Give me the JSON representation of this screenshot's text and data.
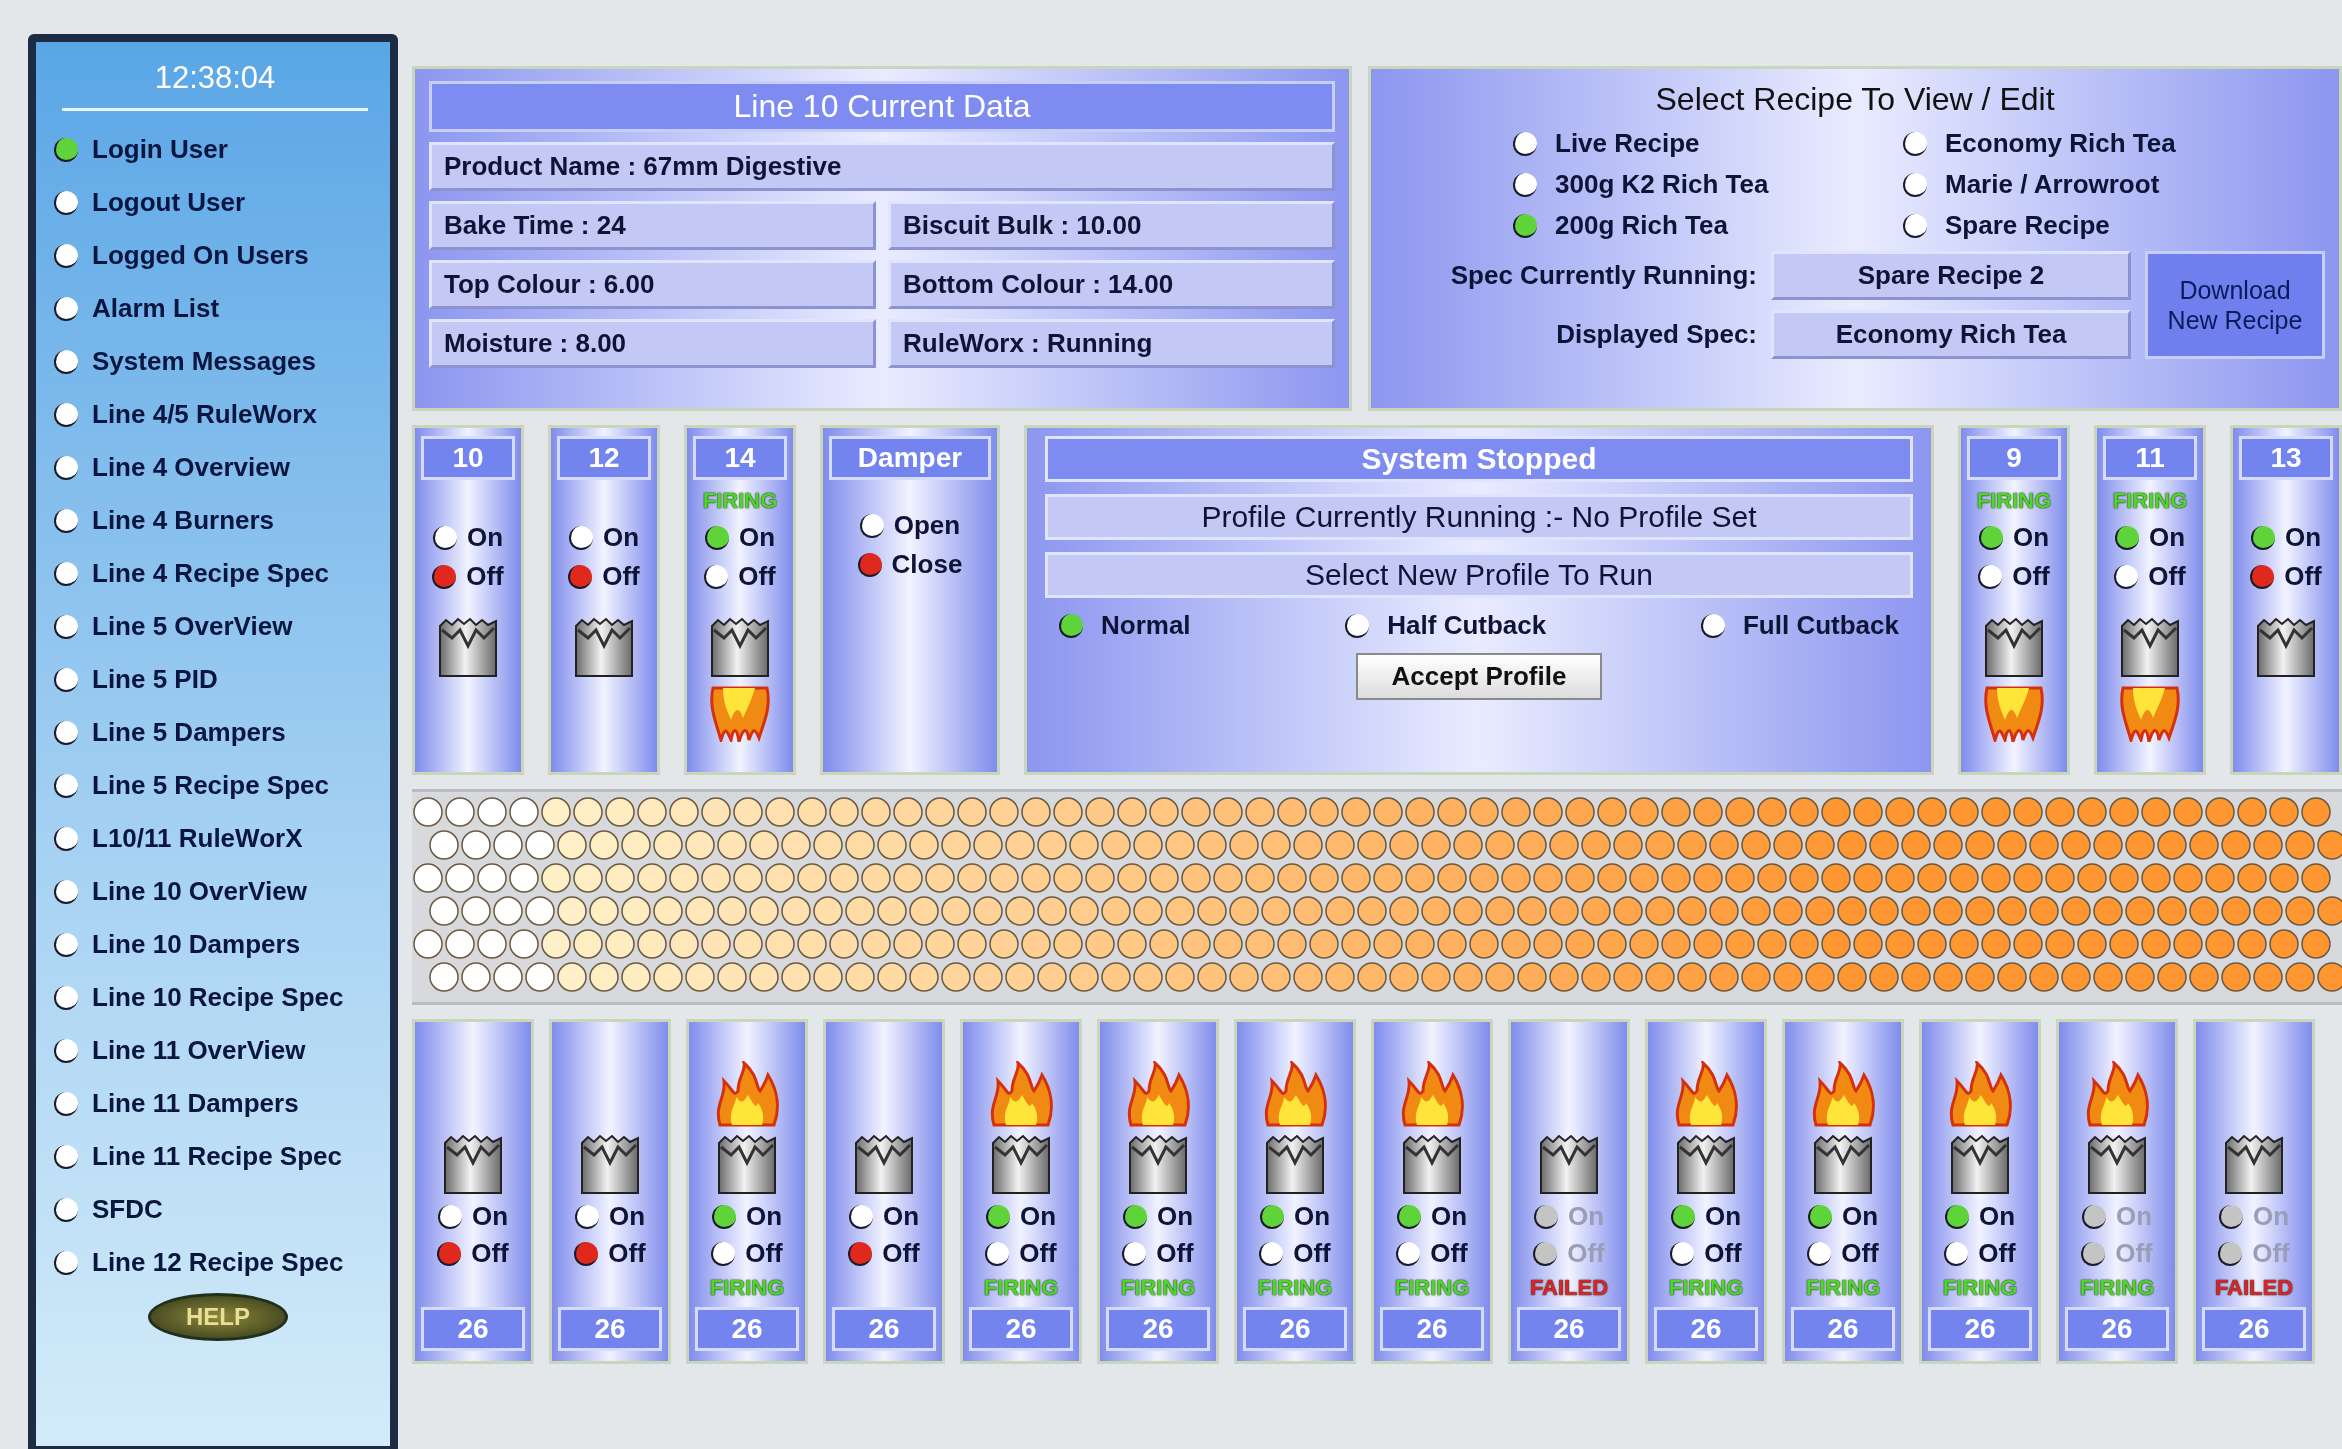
{
  "sidebar": {
    "clock": "12:38:04",
    "items": [
      {
        "label": "Login User",
        "selected": true
      },
      {
        "label": "Logout User",
        "selected": false
      },
      {
        "label": "Logged On Users",
        "selected": false
      },
      {
        "label": "Alarm List",
        "selected": false
      },
      {
        "label": "System Messages",
        "selected": false
      },
      {
        "label": "Line 4/5 RuleWorx",
        "selected": false
      },
      {
        "label": "Line 4 Overview",
        "selected": false
      },
      {
        "label": "Line 4 Burners",
        "selected": false
      },
      {
        "label": "Line 4 Recipe Spec",
        "selected": false
      },
      {
        "label": "Line 5 OverView",
        "selected": false
      },
      {
        "label": "Line 5 PID",
        "selected": false
      },
      {
        "label": "Line 5 Dampers",
        "selected": false
      },
      {
        "label": "Line 5 Recipe Spec",
        "selected": false
      },
      {
        "label": "L10/11 RuleWorX",
        "selected": false
      },
      {
        "label": "Line 10 OverView",
        "selected": false
      },
      {
        "label": "Line 10 Dampers",
        "selected": false
      },
      {
        "label": "Line 10 Recipe Spec",
        "selected": false
      },
      {
        "label": "Line 11 OverView",
        "selected": false
      },
      {
        "label": "Line 11 Dampers",
        "selected": false
      },
      {
        "label": "Line 11 Recipe Spec",
        "selected": false
      },
      {
        "label": "SFDC",
        "selected": false
      },
      {
        "label": "Line 12 Recipe Spec",
        "selected": false
      }
    ],
    "help_button": "HELP"
  },
  "current_data": {
    "title": "Line 10 Current Data",
    "product": "Product Name : 67mm Digestive",
    "fields": [
      "Bake Time : 24",
      "Biscuit Bulk : 10.00",
      "Top Colour : 6.00",
      "Bottom Colour : 14.00",
      "Moisture : 8.00",
      "RuleWorx : Running"
    ]
  },
  "recipe": {
    "title": "Select Recipe To View / Edit",
    "options": [
      {
        "label": "Live Recipe",
        "selected": false
      },
      {
        "label": "Economy Rich Tea",
        "selected": false
      },
      {
        "label": "300g K2 Rich Tea",
        "selected": false
      },
      {
        "label": "Marie / Arrowroot",
        "selected": false
      },
      {
        "label": "200g Rich Tea",
        "selected": true
      },
      {
        "label": "Spare Recipe",
        "selected": false
      }
    ],
    "spec_running_label": "Spec Currently Running:",
    "spec_running": "Spare Recipe 2",
    "displayed_label": "Displayed Spec:",
    "displayed": "Economy Rich Tea",
    "download_button": "Download New Recipe"
  },
  "top_left_burners": [
    {
      "label": "10",
      "flame": false,
      "switches": [
        {
          "label": "On",
          "color": "#ffffff"
        },
        {
          "label": "Off",
          "color": "#e0281c"
        }
      ]
    },
    {
      "label": "12",
      "flame": false,
      "switches": [
        {
          "label": "On",
          "color": "#ffffff"
        },
        {
          "label": "Off",
          "color": "#e0281c"
        }
      ]
    },
    {
      "label": "14",
      "flame": true,
      "status": {
        "kind": "firing",
        "text": "FIRING"
      },
      "switches": [
        {
          "label": "On",
          "color": "#5fd43a"
        },
        {
          "label": "Off",
          "color": "#ffffff"
        }
      ]
    }
  ],
  "damper": {
    "label": "Damper",
    "switches": [
      {
        "label": "Open",
        "color": "#ffffff"
      },
      {
        "label": "Close",
        "color": "#e0281c"
      }
    ]
  },
  "profile": {
    "status": "System Stopped",
    "running": "Profile Currently Running :-  No Profile Set",
    "select_title": "Select New Profile To Run",
    "options": [
      {
        "label": "Normal",
        "selected": true
      },
      {
        "label": "Half Cutback",
        "selected": false
      },
      {
        "label": "Full Cutback",
        "selected": false
      }
    ],
    "accept_button": "Accept Profile"
  },
  "top_right_burners": [
    {
      "label": "9",
      "flame": true,
      "status": {
        "kind": "firing",
        "text": "FIRING"
      },
      "switches": [
        {
          "label": "On",
          "color": "#5fd43a"
        },
        {
          "label": "Off",
          "color": "#ffffff"
        }
      ]
    },
    {
      "label": "11",
      "flame": true,
      "status": {
        "kind": "firing",
        "text": "FIRING"
      },
      "switches": [
        {
          "label": "On",
          "color": "#5fd43a"
        },
        {
          "label": "Off",
          "color": "#ffffff"
        }
      ]
    },
    {
      "label": "13",
      "flame": false,
      "switches": [
        {
          "label": "On",
          "color": "#5fd43a"
        },
        {
          "label": "Off",
          "color": "#e0281c"
        }
      ]
    }
  ],
  "bottom_burners": [
    {
      "label": "26",
      "flame": false,
      "disabled": false,
      "switches": [
        {
          "label": "On",
          "color": "#ffffff"
        },
        {
          "label": "Off",
          "color": "#e0281c"
        }
      ]
    },
    {
      "label": "26",
      "flame": false,
      "disabled": false,
      "switches": [
        {
          "label": "On",
          "color": "#ffffff"
        },
        {
          "label": "Off",
          "color": "#e0281c"
        }
      ]
    },
    {
      "label": "26",
      "flame": true,
      "disabled": false,
      "status": {
        "kind": "firing",
        "text": "FIRING"
      },
      "switches": [
        {
          "label": "On",
          "color": "#5fd43a"
        },
        {
          "label": "Off",
          "color": "#ffffff"
        }
      ]
    },
    {
      "label": "26",
      "flame": false,
      "disabled": false,
      "switches": [
        {
          "label": "On",
          "color": "#ffffff"
        },
        {
          "label": "Off",
          "color": "#e0281c"
        }
      ]
    },
    {
      "label": "26",
      "flame": true,
      "disabled": false,
      "status": {
        "kind": "firing",
        "text": "FIRING"
      },
      "switches": [
        {
          "label": "On",
          "color": "#5fd43a"
        },
        {
          "label": "Off",
          "color": "#ffffff"
        }
      ]
    },
    {
      "label": "26",
      "flame": true,
      "disabled": false,
      "status": {
        "kind": "firing",
        "text": "FIRING"
      },
      "switches": [
        {
          "label": "On",
          "color": "#5fd43a"
        },
        {
          "label": "Off",
          "color": "#ffffff"
        }
      ]
    },
    {
      "label": "26",
      "flame": true,
      "disabled": false,
      "status": {
        "kind": "firing",
        "text": "FIRING"
      },
      "switches": [
        {
          "label": "On",
          "color": "#5fd43a"
        },
        {
          "label": "Off",
          "color": "#ffffff"
        }
      ]
    },
    {
      "label": "26",
      "flame": true,
      "disabled": false,
      "status": {
        "kind": "firing",
        "text": "FIRING"
      },
      "switches": [
        {
          "label": "On",
          "color": "#5fd43a"
        },
        {
          "label": "Off",
          "color": "#ffffff"
        }
      ]
    },
    {
      "label": "26",
      "flame": false,
      "disabled": true,
      "status": {
        "kind": "failed",
        "text": "FAILED"
      },
      "switches": [
        {
          "label": "On",
          "color": "#c4c4c4"
        },
        {
          "label": "Off",
          "color": "#c4c4c4"
        }
      ]
    },
    {
      "label": "26",
      "flame": true,
      "disabled": false,
      "status": {
        "kind": "firing",
        "text": "FIRING"
      },
      "switches": [
        {
          "label": "On",
          "color": "#5fd43a"
        },
        {
          "label": "Off",
          "color": "#ffffff"
        }
      ]
    },
    {
      "label": "26",
      "flame": true,
      "disabled": false,
      "status": {
        "kind": "firing",
        "text": "FIRING"
      },
      "switches": [
        {
          "label": "On",
          "color": "#5fd43a"
        },
        {
          "label": "Off",
          "color": "#ffffff"
        }
      ]
    },
    {
      "label": "26",
      "flame": true,
      "disabled": false,
      "status": {
        "kind": "firing",
        "text": "FIRING"
      },
      "switches": [
        {
          "label": "On",
          "color": "#5fd43a"
        },
        {
          "label": "Off",
          "color": "#ffffff"
        }
      ]
    },
    {
      "label": "26",
      "flame": true,
      "disabled": true,
      "status": {
        "kind": "firing",
        "text": "FIRING"
      },
      "switches": [
        {
          "label": "On",
          "color": "#c4c4c4"
        },
        {
          "label": "Off",
          "color": "#c4c4c4"
        }
      ]
    },
    {
      "label": "26",
      "flame": false,
      "disabled": true,
      "status": {
        "kind": "failed",
        "text": "FAILED"
      },
      "switches": [
        {
          "label": "On",
          "color": "#c4c4c4"
        },
        {
          "label": "Off",
          "color": "#c4c4c4"
        }
      ]
    }
  ]
}
